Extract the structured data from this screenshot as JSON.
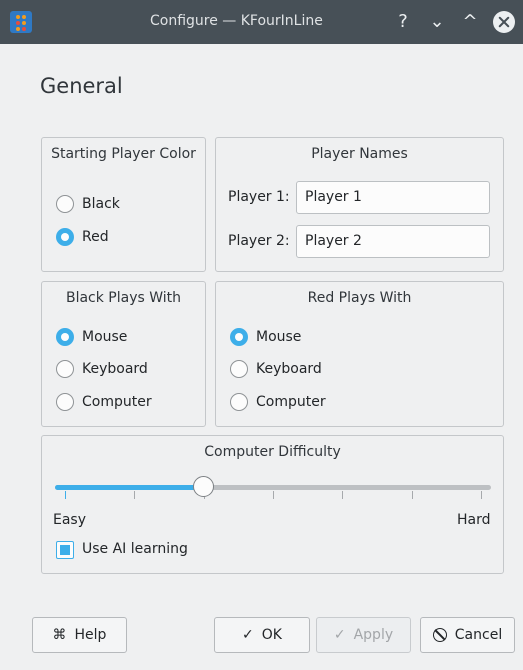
{
  "window": {
    "title": "Configure — KFourInLine",
    "help_glyph": "?",
    "minimize_glyph": "⌄",
    "maximize_glyph": "^"
  },
  "page": {
    "title": "General"
  },
  "starting_player_color": {
    "title": "Starting Player Color",
    "options": [
      {
        "label": "Black",
        "checked": false
      },
      {
        "label": "Red",
        "checked": true
      }
    ]
  },
  "player_names": {
    "title": "Player Names",
    "player1_label": "Player 1:",
    "player1_value": "Player 1",
    "player2_label": "Player 2:",
    "player2_value": "Player 2"
  },
  "black_plays_with": {
    "title": "Black Plays With",
    "options": [
      {
        "label": "Mouse",
        "checked": true
      },
      {
        "label": "Keyboard",
        "checked": false
      },
      {
        "label": "Computer",
        "checked": false
      }
    ]
  },
  "red_plays_with": {
    "title": "Red Plays With",
    "options": [
      {
        "label": "Mouse",
        "checked": true
      },
      {
        "label": "Keyboard",
        "checked": false
      },
      {
        "label": "Computer",
        "checked": false
      }
    ]
  },
  "computer_difficulty": {
    "title": "Computer Difficulty",
    "min_label": "Easy",
    "max_label": "Hard",
    "level_fraction": 0.34,
    "tick_count": 7,
    "use_ai_learning_label": "Use AI learning",
    "use_ai_learning": true
  },
  "buttons": {
    "help": {
      "label": "Help",
      "icon": "help-book-icon",
      "glyph": "⌘"
    },
    "ok": {
      "label": "OK",
      "icon": "check-icon",
      "glyph": "✓"
    },
    "apply": {
      "label": "Apply",
      "icon": "check-icon",
      "glyph": "✓",
      "disabled": true
    },
    "cancel": {
      "label": "Cancel",
      "icon": "cancel-icon",
      "glyph": "⃠"
    }
  },
  "colors": {
    "accent": "#3daee9",
    "titlebar": "#475057",
    "background": "#eff0f1"
  }
}
